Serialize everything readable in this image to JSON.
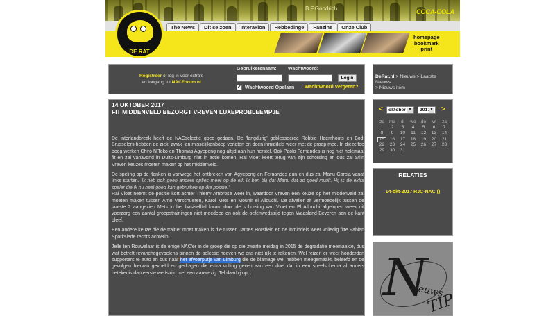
{
  "header": {
    "logo_text": "DE RAT",
    "strip_text_1": "B.F.Goodrich",
    "strip_text_2": "COCA-COLA",
    "nav": [
      "The News",
      "Dit seizoen",
      "Interaxion",
      "Hebbedinge",
      "Fanzine",
      "Onze Club"
    ],
    "quick_links": [
      "homepage",
      "bookmark",
      "print"
    ]
  },
  "login": {
    "register": "Registreer",
    "register_rest": " of log in voor extra's",
    "line2_pre": "en toegang tot ",
    "forum": "NACForum.nl",
    "username_label": "Gebruikersnaam:",
    "password_label": "Wachtwoord:",
    "login_button": "Login",
    "remember_label": "Wachtwoord Opslaan",
    "forgot_link": "Wachtwoord Vergeten?"
  },
  "article": {
    "date": "14 OKTOBER 2017",
    "title": "FIT MIDDENVELD BEZORGT VREVEN LUXEPROBLEEMPJE",
    "p1": "De interlandbreak heeft de NACselectie goed gedaan. De 'langdurig' geblesseerde Robbie Haemhouts en Bodi Brusselers hebben de ziek, zwak -en misselijkenboeg verlaten en doen inmiddels weer met de groep mee. In diezelfde boeg werken Chiró N'Toko en Thomas Agyepong nog altijd aan hun herstel. Ook Paolo Fernandes is nog niet helemaal fit en zal vanavond in Duits-Limburg niet in actie komen. Rai Vloet keert terug van zijn schorsing en dus zal Stijn Vreven keuzes moeten maken op het middenveld.",
    "p2a": "De speling op de flanken is vanwege het ontbreken van Agyepong en Fernandes dun en dus zal Manu Garcia vanaf links starten. ",
    "p2_quote": "'Ik heb ook geen andere opties meer op de elf. Ik ben blij dat Manu dat zo goed invult. Hij is de extra speler die ik nu heel goed kan gebruiken op die positie.'",
    "p2b": "Rai Vloet neemt de positie kort achter Thierry Ambrose weer in, waardoor Vreven een keuze op het middenveld zal moeten maken tussen Arno Verschueren, Karol Mets en Mounir el Allouchi. De afvaller zit vermoedelijk tussen de laatste 2 aangezien Mets in het basiselftal kwam door de schorsing van Vloet en El Allouchi afgelopen week uit voorzorg een aantal groepstrainingen niet meedeed en ook de oefenwedstrijd tegen Waasland-Beveren aan de kant bleef.",
    "p3": "Een andere keuze die de trainer moet maken is die tussen James Horsfield en de inmiddels weer volledig fitte Fabian Sporkslede rechts achterin.",
    "p4a": "Jelle ten Rouwelaar is de enige NAC'er in de groep die op die zwarte meidag in 2015 de degradatie meemaakte, dus wat betreft revanchegevoelens binnen de selectie hoeven we ons niet rijk te rekenen. Wel reizen er weer honderden supporters te auto en bus naar ",
    "p4_highlight": "het afvoerputje van Limburg",
    "p4b": " die de blamage wel hebben meegemaakt, beleefd en de gevolgen hiervan gevoeld en gedragen die extra vulling geven aan een duel dat in een speelschema al anders betekenis dan eerste wedstrijd met een aanwezig. Tel daarbij op..."
  },
  "breadcrumb": {
    "root": "DeRat.nl",
    "sep": " > ",
    "items": [
      "Nieuws",
      "Laatste Nieuws",
      "Nieuws item"
    ]
  },
  "calendar": {
    "prev": "<",
    "next": ">",
    "month": "oktober",
    "year": "2017",
    "weekdays": [
      "zo",
      "ma",
      "di",
      "wo",
      "do",
      "vr",
      "za"
    ],
    "days": [
      "1",
      "2",
      "3",
      "4",
      "5",
      "6",
      "7",
      "8",
      "9",
      "10",
      "11",
      "12",
      "13",
      "14",
      "15",
      "16",
      "17",
      "18",
      "19",
      "20",
      "21",
      "22",
      "23",
      "24",
      "25",
      "26",
      "27",
      "28",
      "29",
      "30",
      "31"
    ],
    "today": "15"
  },
  "relaties": {
    "heading": "RELATIES",
    "item": "14-okt-2017 RJC-NAC ()"
  },
  "tip": {
    "big_letter": "N",
    "word": "ieuws",
    "tip": "TIP?"
  },
  "colors": {
    "accent": "#f4e61a",
    "panel": "#4a4a4a",
    "highlight": "#2f6fd0"
  }
}
